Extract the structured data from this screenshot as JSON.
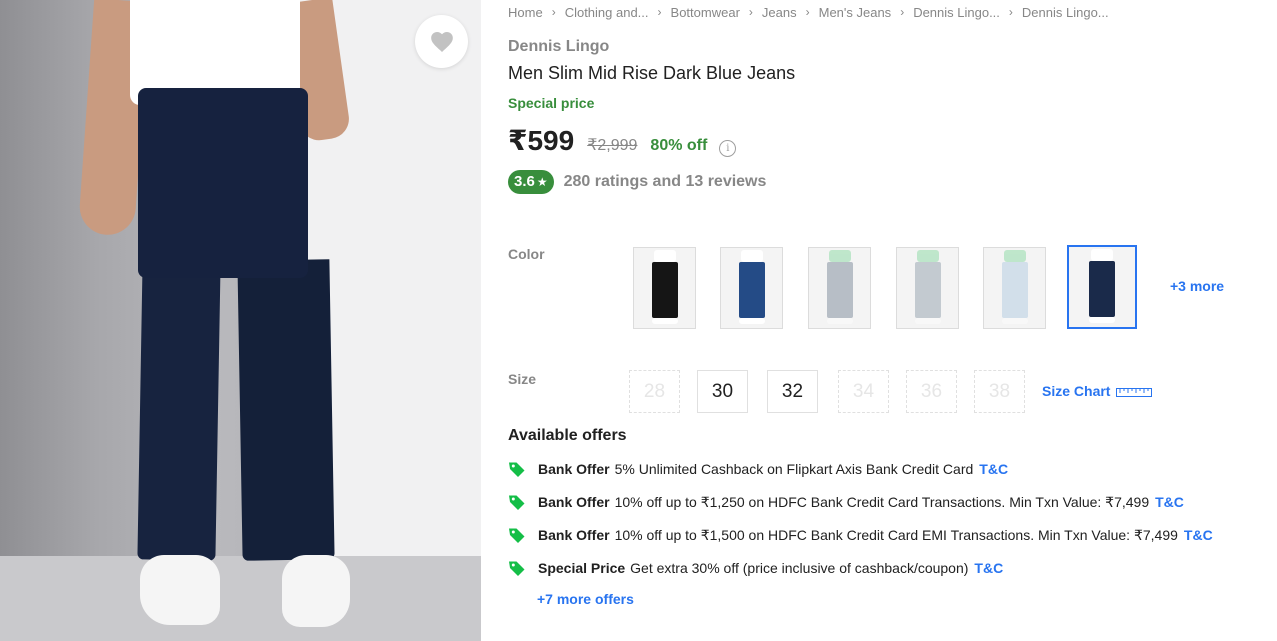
{
  "breadcrumbs": [
    "Home",
    "Clothing and...",
    "Bottomwear",
    "Jeans",
    "Men's Jeans",
    "Dennis Lingo...",
    "Dennis Lingo..."
  ],
  "product": {
    "brand": "Dennis Lingo",
    "title": "Men Slim Mid Rise Dark Blue Jeans",
    "special_label": "Special price",
    "price": "₹599",
    "mrp": "₹2,999",
    "discount": "80% off",
    "info_glyph": "i",
    "rating": "3.6",
    "rating_star": "★",
    "rating_summary": "280 ratings and 13 reviews"
  },
  "color": {
    "label": "Color",
    "swatches": [
      {
        "shirt": "#ffffff",
        "jeans": "#151515",
        "selected": false,
        "available": true
      },
      {
        "shirt": "#ffffff",
        "jeans": "#244b86",
        "selected": false,
        "available": true
      },
      {
        "shirt": "#7fd69a",
        "jeans": "#6f7f8f",
        "selected": false,
        "available": false
      },
      {
        "shirt": "#7fd69a",
        "jeans": "#8a98a6",
        "selected": false,
        "available": false
      },
      {
        "shirt": "#7fd69a",
        "jeans": "#a9c6df",
        "selected": false,
        "available": false
      },
      {
        "shirt": "#ffffff",
        "jeans": "#1a2a4a",
        "selected": true,
        "available": true
      }
    ],
    "more_label": "+3 more"
  },
  "size": {
    "label": "Size",
    "options": [
      {
        "value": "28",
        "available": false
      },
      {
        "value": "30",
        "available": true
      },
      {
        "value": "32",
        "available": true
      },
      {
        "value": "34",
        "available": false
      },
      {
        "value": "36",
        "available": false
      },
      {
        "value": "38",
        "available": false
      }
    ],
    "chart_label": "Size Chart"
  },
  "offers": {
    "heading": "Available offers",
    "items": [
      {
        "type": "Bank Offer",
        "text": "5% Unlimited Cashback on Flipkart Axis Bank Credit Card",
        "link": "T&C"
      },
      {
        "type": "Bank Offer",
        "text": "10% off up to ₹1,250 on HDFC Bank Credit Card Transactions. Min Txn Value: ₹7,499",
        "link": "T&C"
      },
      {
        "type": "Bank Offer",
        "text": "10% off up to ₹1,500 on HDFC Bank Credit Card EMI Transactions. Min Txn Value: ₹7,499",
        "link": "T&C"
      },
      {
        "type": "Special Price",
        "text": "Get extra 30% off (price inclusive of cashback/coupon)",
        "link": "T&C"
      }
    ],
    "more_label": "+7 more offers"
  },
  "colors": {
    "accent_blue": "#2874f0",
    "green": "#388e3c",
    "grey_text": "#878787",
    "offer_tag": "#14be47"
  },
  "icons": {
    "wishlist": "heart-icon",
    "breadcrumb_sep": "chevron-right-icon",
    "info": "info-icon",
    "offer": "tag-icon",
    "size_chart": "ruler-icon"
  }
}
